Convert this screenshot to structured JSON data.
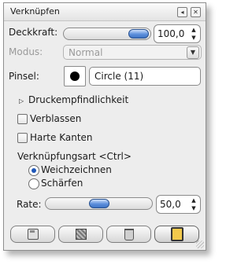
{
  "title": "Verknüpfen",
  "window_buttons": [
    {
      "name": "menu",
      "icon": "menu-arrow-icon"
    },
    {
      "name": "close",
      "icon": "close-icon"
    }
  ],
  "opacity": {
    "label": "Deckkraft:",
    "value": "100,0",
    "fraction": 1.0
  },
  "mode": {
    "label": "Modus:",
    "value": "Normal",
    "disabled": true
  },
  "brush": {
    "label": "Pinsel:",
    "name": "Circle (11)"
  },
  "pressure": {
    "label": "Druckempfindlichkeit",
    "expanded": false
  },
  "options": {
    "fade": "Verblassen",
    "hard_edges": "Harte Kanten"
  },
  "convolve": {
    "label": "Verknüpfungsart  <Ctrl>",
    "choices": [
      {
        "label": "Weichzeichnen",
        "selected": true
      },
      {
        "label": "Schärfen",
        "selected": false
      }
    ]
  },
  "rate": {
    "label": "Rate:",
    "value": "50,0",
    "fraction": 0.5
  },
  "accent_color": "#3f74c6",
  "bottom_buttons": [
    {
      "name": "save",
      "icon": "save-icon"
    },
    {
      "name": "restore",
      "icon": "restore-icon"
    },
    {
      "name": "delete",
      "icon": "trash-icon"
    },
    {
      "name": "reset",
      "icon": "reset-icon"
    }
  ]
}
